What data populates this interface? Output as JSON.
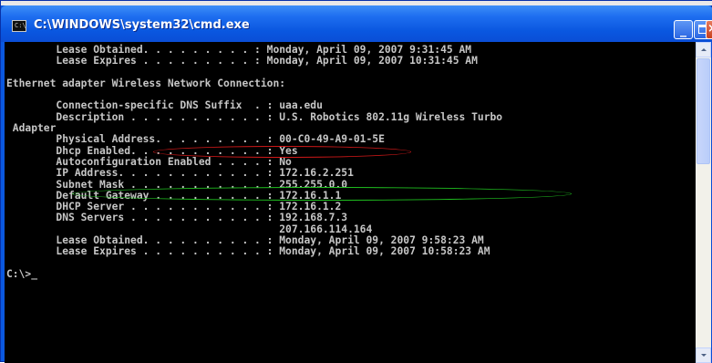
{
  "window": {
    "title": "C:\\WINDOWS\\system32\\cmd.exe",
    "icon_text": "C:\\",
    "minimize_glyph": "_",
    "close_glyph": "×"
  },
  "console": {
    "lines": [
      "        Lease Obtained. . . . . . . . . : Monday, April 09, 2007 9:31:45 AM",
      "        Lease Expires . . . . . . . . . : Monday, April 09, 2007 10:31:45 AM",
      "",
      "Ethernet adapter Wireless Network Connection:",
      "",
      "        Connection-specific DNS Suffix  . : uaa.edu",
      "        Description . . . . . . . . . . . : U.S. Robotics 802.11g Wireless Turbo",
      " Adapter",
      "        Physical Address. . . . . . . . . : 00-C0-49-A9-01-5E",
      "        Dhcp Enabled. . . . . . . . . . . : Yes",
      "        Autoconfiguration Enabled . . . . : No",
      "        IP Address. . . . . . . . . . . . : 172.16.2.251",
      "        Subnet Mask . . . . . . . . . . . : 255.255.0.0",
      "        Default Gateway . . . . . . . . . : 172.16.1.1",
      "        DHCP Server . . . . . . . . . . . : 172.16.1.2",
      "        DNS Servers . . . . . . . . . . . : 192.168.7.3",
      "                                            207.166.114.164",
      "        Lease Obtained. . . . . . . . . . : Monday, April 09, 2007 9:58:23 AM",
      "        Lease Expires . . . . . . . . . . : Monday, April 09, 2007 10:58:23 AM",
      "",
      "C:\\>_"
    ]
  },
  "annotations": {
    "wireless_highlight_color": "#d01818",
    "physical_address_highlight_color": "#1fbf1f"
  },
  "colors": {
    "titlebar": "#0a57e0",
    "console_bg": "#000000",
    "console_text": "#c6c6c6"
  }
}
